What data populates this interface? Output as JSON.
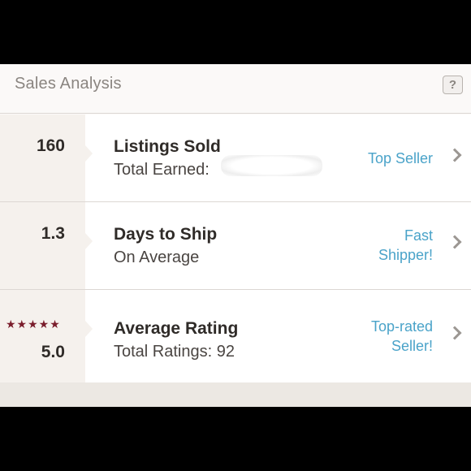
{
  "header": {
    "title": "Sales Analysis",
    "help_label": "?"
  },
  "rows": [
    {
      "value": "160",
      "title": "Listings Sold",
      "subtitle": "Total Earned:",
      "badge": "Top Seller"
    },
    {
      "value": "1.3",
      "title": "Days to Ship",
      "subtitle": "On Average",
      "badge_line1": "Fast",
      "badge_line2": "Shipper!"
    },
    {
      "rating_stars": "★★★★★",
      "value": "5.0",
      "title": "Average Rating",
      "subtitle": "Total Ratings: 92",
      "badge_line1": "Top-rated",
      "badge_line2": "Seller!"
    }
  ],
  "icons": {
    "chevron": "chevron-right-icon",
    "help": "help-icon",
    "star": "star-icon"
  },
  "colors": {
    "accent_link": "#4aa3c9",
    "star": "#7a1d2c",
    "stat_panel": "#f5f1ed"
  }
}
